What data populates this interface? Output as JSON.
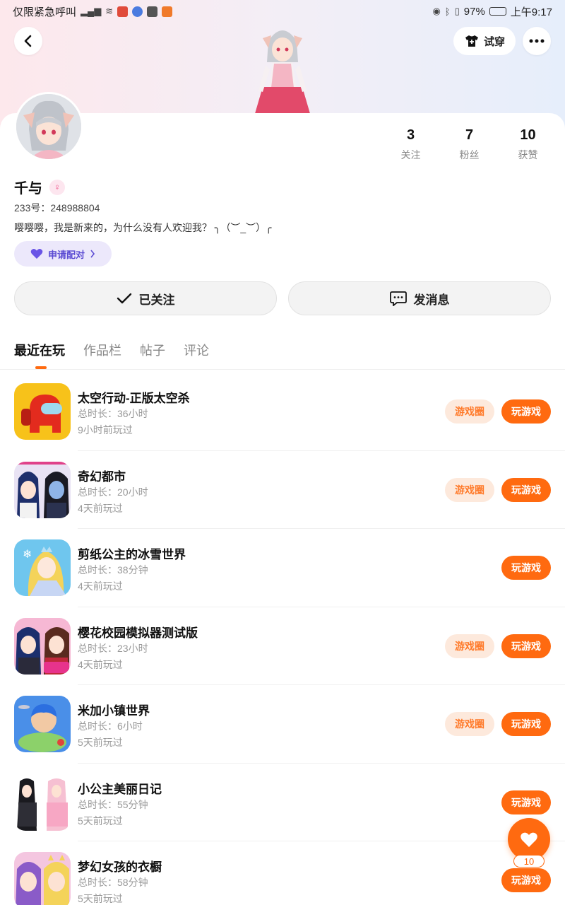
{
  "status_bar": {
    "left_text": "仅限紧急呼叫",
    "battery": "97%",
    "time": "上午9:17"
  },
  "header": {
    "tryon_label": "试穿"
  },
  "profile": {
    "name": "千与",
    "uid": "233号：248988804",
    "bio": "嘤嘤嘤，我是新来的，为什么没有人欢迎我？ ╮（︶_︶）╭",
    "pair_label": "申请配对",
    "follow_label": "已关注",
    "message_label": "发消息"
  },
  "stats": [
    {
      "num": "3",
      "label": "关注"
    },
    {
      "num": "7",
      "label": "粉丝"
    },
    {
      "num": "10",
      "label": "获赞"
    }
  ],
  "tabs": [
    "最近在玩",
    "作品栏",
    "帖子",
    "评论"
  ],
  "game_actions": {
    "circle_label": "游戏圈",
    "play_label": "玩游戏"
  },
  "games": [
    {
      "title": "太空行动-正版太空杀",
      "duration": "总时长：36小时",
      "last": "9小时前玩过",
      "has_circle": true
    },
    {
      "title": "奇幻都市",
      "duration": "总时长：20小时",
      "last": "4天前玩过",
      "has_circle": true
    },
    {
      "title": "剪纸公主的冰雪世界",
      "duration": "总时长：38分钟",
      "last": "4天前玩过",
      "has_circle": false
    },
    {
      "title": "樱花校园模拟器测试版",
      "duration": "总时长：23小时",
      "last": "4天前玩过",
      "has_circle": true
    },
    {
      "title": "米加小镇世界",
      "duration": "总时长：6小时",
      "last": "5天前玩过",
      "has_circle": true
    },
    {
      "title": "小公主美丽日记",
      "duration": "总时长：55分钟",
      "last": "5天前玩过",
      "has_circle": false
    },
    {
      "title": "梦幻女孩的衣橱",
      "duration": "总时长：58分钟",
      "last": "5天前玩过",
      "has_circle": false
    }
  ],
  "like_fab": {
    "count": "10"
  },
  "colors": {
    "accent": "#ff6a10",
    "accent_soft": "#fde9dc",
    "pair_bg": "#ece8fb",
    "pair_text": "#5b4bd3"
  }
}
